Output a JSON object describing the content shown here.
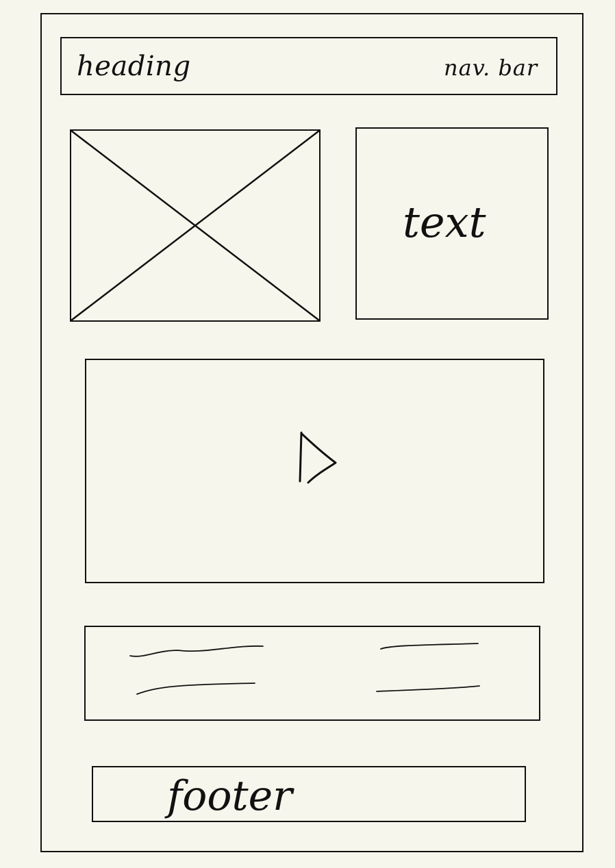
{
  "sketch": {
    "heading_label": "heading",
    "nav_label": "nav. bar",
    "text_label": "text",
    "footer_label": "footer"
  },
  "icons": {
    "image_placeholder": "image-placeholder-icon",
    "video_play": "play-icon",
    "link_lines": "scribble-line-icon"
  },
  "colors": {
    "background": "#f6f6ec",
    "ink": "#111111"
  }
}
